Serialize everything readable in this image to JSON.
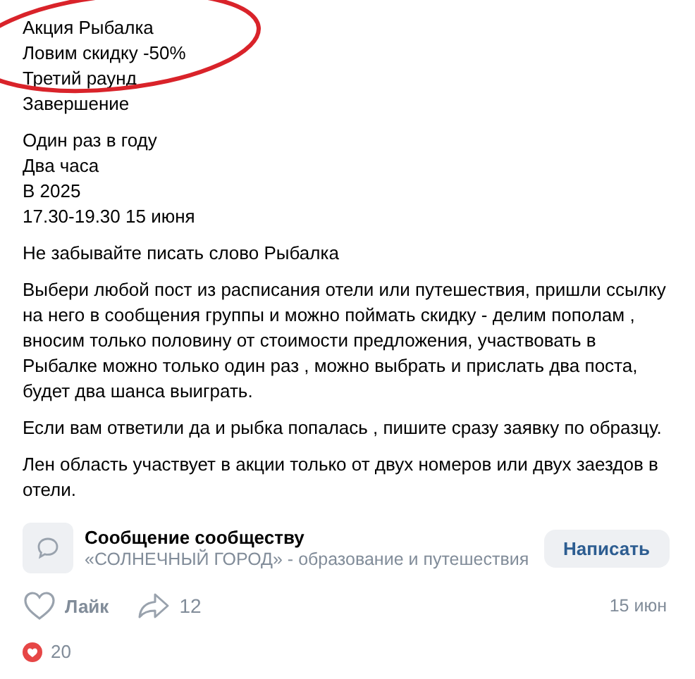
{
  "annotation": {
    "kind": "ellipse"
  },
  "post": {
    "blocks": [
      {
        "lines": [
          "Акция Рыбалка",
          "Ловим скидку -50%",
          "Третий раунд",
          "Завершение"
        ]
      },
      {
        "lines": [
          "Один раз в году",
          "Два часа",
          "В 2025",
          "17.30-19.30 15 июня"
        ]
      },
      {
        "lines": [
          "Не забывайте писать слово Рыбалка"
        ]
      },
      {
        "lines": [
          "Выбери любой пост из расписания отели или путешествия, пришли ссылку на него в сообщения группы и можно поймать скидку - делим пополам , вносим только половину от стоимости предложения, участвовать в Рыбалке можно только один раз , можно выбрать и прислать два поста, будет два шанса выиграть."
        ]
      },
      {
        "lines": [
          "Если вам ответили да и рыбка попалась , пишите сразу заявку по образцу."
        ]
      },
      {
        "lines": [
          "Лен область участвует в акции только от двух номеров или двух заездов в отели."
        ]
      }
    ]
  },
  "community_card": {
    "title": "Сообщение сообществу",
    "subtitle": "«СОЛНЕЧНЫЙ ГОРОД» - образование и путешествия",
    "button": "Написать"
  },
  "actions": {
    "like": {
      "label": "Лайк",
      "liked": false
    },
    "share": {
      "count": "12"
    },
    "date": "15 июн"
  },
  "reactions": {
    "count": "20"
  }
}
